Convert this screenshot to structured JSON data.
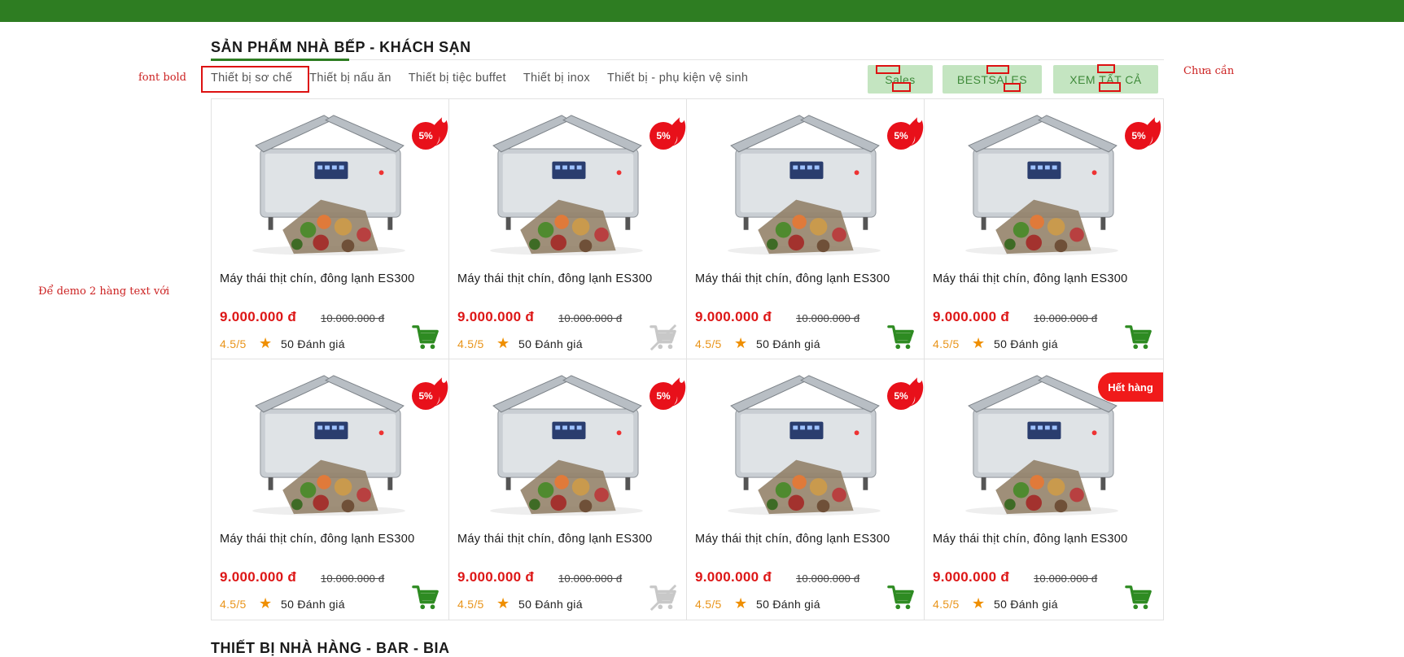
{
  "section": {
    "title": "SẢN PHẨM NHÀ BẾP - KHÁCH SẠN",
    "next_title": "THIẾT BỊ NHÀ HÀNG - BAR - BIA"
  },
  "notes": {
    "font_bold": "font bold",
    "chua_can": "Chưa cần",
    "de_demo": "Để demo 2 hàng text với"
  },
  "tabs": [
    {
      "label": "Thiết bị sơ chế"
    },
    {
      "label": "Thiết bị nấu ăn"
    },
    {
      "label": "Thiết bị tiệc buffet"
    },
    {
      "label": "Thiết bị inox"
    },
    {
      "label": "Thiết bị - phụ kiện vệ sinh"
    }
  ],
  "filters": {
    "sales": "Sales",
    "bestsales": "BESTSALES",
    "view_all": "XEM TẤT CẢ"
  },
  "colors": {
    "brand_green": "#2e7d22",
    "sale_red": "#e8101a",
    "price_red": "#dd1616",
    "rating_orange": "#e9941a",
    "cart_active": "#2e8b22",
    "cart_disabled": "#c8c8c8"
  },
  "products": [
    {
      "name": "Máy thái thịt chín, đông lạnh ES300",
      "price": "9.000.000 đ",
      "old_price": "10.000.000 đ",
      "rating": "4.5/5",
      "reviews": "50 Đánh giá",
      "badge": "5%",
      "cart_icon": "cart-icon",
      "in_stock": true
    },
    {
      "name": "Máy thái thịt chín, đông lạnh ES300",
      "price": "9.000.000 đ",
      "old_price": "10.000.000 đ",
      "rating": "4.5/5",
      "reviews": "50 Đánh giá",
      "badge": "5%",
      "cart_icon": "cart-off-icon",
      "in_stock": false
    },
    {
      "name": "Máy thái thịt chín, đông lạnh ES300",
      "price": "9.000.000 đ",
      "old_price": "10.000.000 đ",
      "rating": "4.5/5",
      "reviews": "50 Đánh giá",
      "badge": "5%",
      "cart_icon": "cart-icon",
      "in_stock": true
    },
    {
      "name": "Máy thái thịt chín, đông lạnh ES300",
      "price": "9.000.000 đ",
      "old_price": "10.000.000 đ",
      "rating": "4.5/5",
      "reviews": "50 Đánh giá",
      "badge": "5%",
      "cart_icon": "cart-icon",
      "in_stock": true
    },
    {
      "name": "Máy thái thịt chín, đông lạnh ES300",
      "price": "9.000.000 đ",
      "old_price": "10.000.000 đ",
      "rating": "4.5/5",
      "reviews": "50 Đánh giá",
      "badge": "5%",
      "cart_icon": "cart-icon",
      "in_stock": true
    },
    {
      "name": "Máy thái thịt chín, đông lạnh ES300",
      "price": "9.000.000 đ",
      "old_price": "10.000.000 đ",
      "rating": "4.5/5",
      "reviews": "50 Đánh giá",
      "badge": "5%",
      "cart_icon": "cart-off-icon",
      "in_stock": false
    },
    {
      "name": "Máy thái thịt chín, đông lạnh ES300",
      "price": "9.000.000 đ",
      "old_price": "10.000.000 đ",
      "rating": "4.5/5",
      "reviews": "50 Đánh giá",
      "badge": "5%",
      "cart_icon": "cart-icon",
      "in_stock": true
    },
    {
      "name": "Máy thái thịt chín, đông lạnh ES300",
      "price": "9.000.000 đ",
      "old_price": "10.000.000 đ",
      "rating": "4.5/5",
      "reviews": "50 Đánh giá",
      "sold_out_label": "Hết hàng",
      "cart_icon": "cart-icon",
      "in_stock": true
    }
  ]
}
